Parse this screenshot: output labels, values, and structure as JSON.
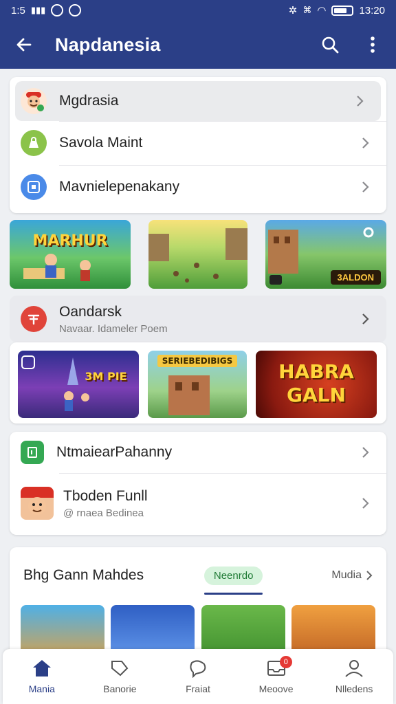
{
  "status": {
    "time_left": "1:5",
    "time_right": "13:20"
  },
  "appbar": {
    "title": "Napdanesia"
  },
  "menu1": [
    {
      "label": "Mgdrasia",
      "icon": "mascot-icon",
      "selected": true
    },
    {
      "label": "Savola Maint",
      "icon": "bag-icon"
    },
    {
      "label": "Mavnielepenakany",
      "icon": "app-icon"
    }
  ],
  "thumbs1": [
    {
      "caption": "MARHUR"
    },
    {
      "caption": ""
    },
    {
      "caption": "3ALDON"
    }
  ],
  "section2": {
    "label": "Oandarsk",
    "sub": "Navaar. Idameler Poem"
  },
  "thumbs2": [
    {
      "caption": "3M PIE"
    },
    {
      "caption": "SERIEBEDIBIGS"
    },
    {
      "caption": "HABRA GALN"
    }
  ],
  "menu2": [
    {
      "label": "NtmaiearPahanny",
      "icon": "flag-icon"
    },
    {
      "label": "Tboden Funll",
      "sub": "@ rnaea Bedinea",
      "icon": "avatar"
    }
  ],
  "games": {
    "title": "Bhg Gann Mahdes",
    "chip": "Neenrdo",
    "more": "Mudia"
  },
  "nav": [
    {
      "label": "Mania",
      "icon": "home-icon",
      "active": true
    },
    {
      "label": "Banorie",
      "icon": "tag-icon"
    },
    {
      "label": "Fraiat",
      "icon": "bubble-icon"
    },
    {
      "label": "Meoove",
      "icon": "inbox-icon",
      "badge": "0"
    },
    {
      "label": "Nlledens",
      "icon": "person-icon"
    }
  ],
  "colors": {
    "primary": "#2b3f87",
    "accent_green": "#1f7a35",
    "badge_red": "#e53935"
  }
}
